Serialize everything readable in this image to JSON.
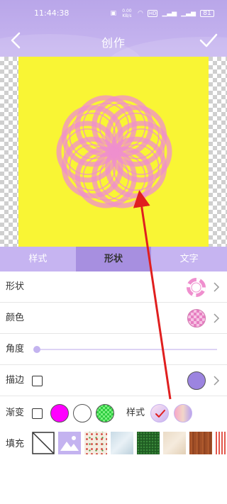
{
  "status_bar": {
    "time": "11:44:38",
    "data_speed": "0.00 KB/s",
    "network_badge": "HD",
    "battery": "81"
  },
  "header": {
    "title": "创作",
    "back_icon": "chevron-left-icon",
    "confirm_icon": "check-icon"
  },
  "canvas": {
    "background_color": "#f9f534",
    "shape_color": "#ef8fce"
  },
  "tabs": [
    {
      "label": "样式",
      "active": false
    },
    {
      "label": "形状",
      "active": true
    },
    {
      "label": "文字",
      "active": false
    }
  ],
  "properties": {
    "shape_label": "形状",
    "color_label": "颜色",
    "angle_label": "角度",
    "angle_value": 0,
    "stroke_label": "描边",
    "stroke_color": "#9c84e0",
    "gradient_label": "渐变",
    "gradient_colors": [
      "#ff00ff",
      "#ffffff",
      "#3ddc4a"
    ],
    "style_label": "样式",
    "fill_label": "填充"
  },
  "fill_options": [
    "none",
    "image",
    "floral-pattern",
    "ice-texture",
    "green-texture",
    "beige-texture",
    "wood-texture",
    "stripes-texture"
  ],
  "accent_color": "#a78fe0",
  "annotation_color": "#e01f1f"
}
